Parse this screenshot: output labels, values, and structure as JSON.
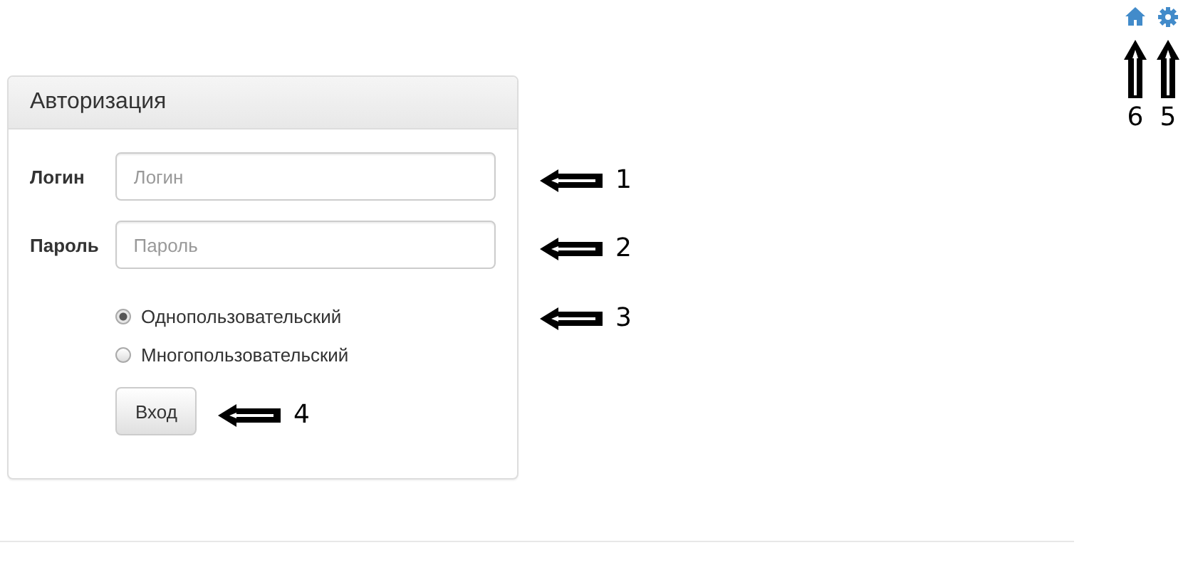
{
  "top_icons": [
    {
      "kind": "home"
    },
    {
      "kind": "settings"
    }
  ],
  "panel": {
    "title": "Авторизация",
    "fields": [
      {
        "label": "Логин",
        "placeholder": "Логин"
      },
      {
        "label": "Пароль",
        "placeholder": "Пароль"
      }
    ],
    "modes": [
      {
        "label": "Однопользовательский",
        "selected": true
      },
      {
        "label": "Многопользовательский",
        "selected": false
      }
    ],
    "submit": "Вход"
  },
  "annotations": [
    {
      "number": "1",
      "kind": "left"
    },
    {
      "number": "2",
      "kind": "left"
    },
    {
      "number": "3",
      "kind": "left"
    },
    {
      "number": "4",
      "kind": "left"
    },
    {
      "number": "6",
      "kind": "up"
    },
    {
      "number": "5",
      "kind": "up"
    }
  ]
}
